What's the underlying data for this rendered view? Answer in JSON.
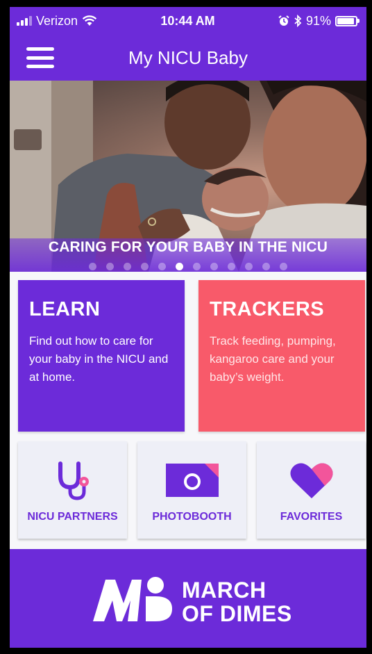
{
  "status_bar": {
    "carrier": "Verizon",
    "time": "10:44 AM",
    "battery_percent": "91%",
    "battery_level": 0.91,
    "icons": [
      "signal-icon",
      "wifi-icon",
      "alarm-icon",
      "bluetooth-icon",
      "battery-icon"
    ]
  },
  "nav": {
    "title": "My NICU Baby",
    "menu_icon": "hamburger-menu-icon"
  },
  "hero": {
    "caption": "CARING FOR YOUR BABY IN THE NICU",
    "dot_count": 12,
    "active_dot": 5
  },
  "cards": {
    "learn": {
      "title": "LEARN",
      "description": "Find out how to care for your baby in the NICU and at home."
    },
    "trackers": {
      "title": "TRACKERS",
      "description": "Track feeding, pumping, kangaroo care and your baby’s weight."
    }
  },
  "tiles": {
    "partners": {
      "label": "NICU PARTNERS",
      "icon": "stethoscope-icon"
    },
    "photobooth": {
      "label": "PHOTOBOOTH",
      "icon": "camera-icon"
    },
    "favorites": {
      "label": "FAVORITES",
      "icon": "heart-icon"
    }
  },
  "footer": {
    "logo_line1": "MARCH",
    "logo_line2": "OF DIMES"
  },
  "colors": {
    "brand_purple": "#6c2bd9",
    "tracker_coral": "#f85a6a",
    "accent_pink": "#f2559b",
    "tile_bg": "#eeeff7"
  }
}
